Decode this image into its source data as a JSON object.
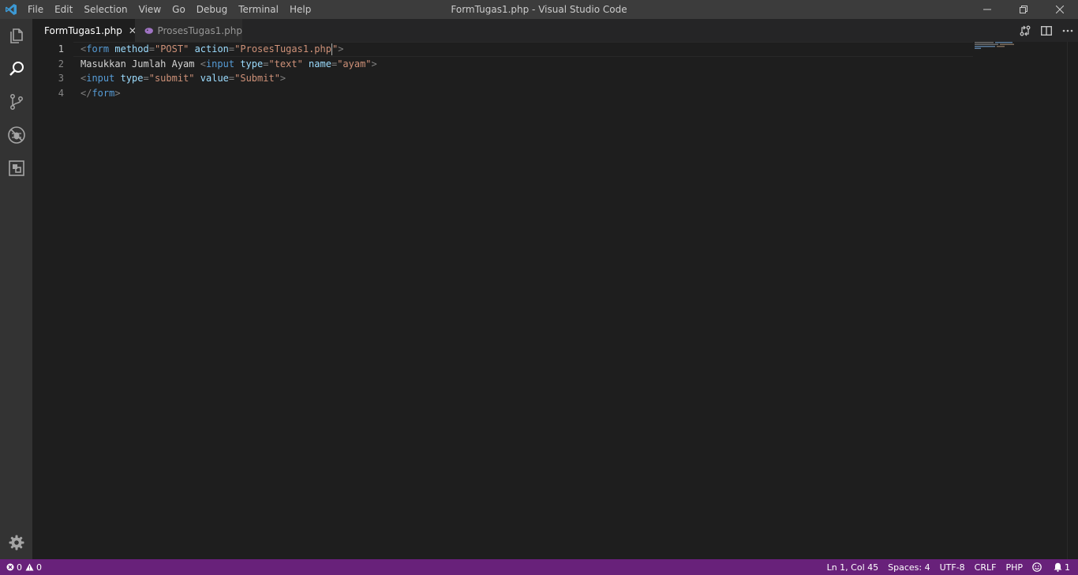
{
  "window": {
    "title": "FormTugas1.php - Visual Studio Code",
    "menu": [
      "File",
      "Edit",
      "Selection",
      "View",
      "Go",
      "Debug",
      "Terminal",
      "Help"
    ]
  },
  "activity_bar": {
    "items": [
      "files-icon",
      "search-icon",
      "source-control-icon",
      "debug-icon",
      "extensions-icon"
    ],
    "bottom": "gear-icon"
  },
  "tabs": [
    {
      "label": "FormTugas1.php",
      "active": true
    },
    {
      "label": "ProsesTugas1.php",
      "active": false
    }
  ],
  "editor": {
    "line_numbers": [
      "1",
      "2",
      "3",
      "4"
    ],
    "lines": [
      [
        [
          "p",
          "<"
        ],
        [
          "t",
          "form"
        ],
        [
          "x",
          " "
        ],
        [
          "a",
          "method"
        ],
        [
          "p",
          "="
        ],
        [
          "s",
          "\"POST\""
        ],
        [
          "x",
          " "
        ],
        [
          "a",
          "action"
        ],
        [
          "p",
          "="
        ],
        [
          "s",
          "\"ProsesTugas1.php"
        ],
        [
          "c",
          ""
        ],
        [
          "s",
          "\""
        ],
        [
          "p",
          ">"
        ]
      ],
      [
        [
          "x",
          "Masukkan Jumlah Ayam "
        ],
        [
          "p",
          "<"
        ],
        [
          "t",
          "input"
        ],
        [
          "x",
          " "
        ],
        [
          "a",
          "type"
        ],
        [
          "p",
          "="
        ],
        [
          "s",
          "\"text\""
        ],
        [
          "x",
          " "
        ],
        [
          "a",
          "name"
        ],
        [
          "p",
          "="
        ],
        [
          "s",
          "\"ayam\""
        ],
        [
          "p",
          ">"
        ]
      ],
      [
        [
          "p",
          "<"
        ],
        [
          "t",
          "input"
        ],
        [
          "x",
          " "
        ],
        [
          "a",
          "type"
        ],
        [
          "p",
          "="
        ],
        [
          "s",
          "\"submit\""
        ],
        [
          "x",
          " "
        ],
        [
          "a",
          "value"
        ],
        [
          "p",
          "="
        ],
        [
          "s",
          "\"Submit\""
        ],
        [
          "p",
          ">"
        ]
      ],
      [
        [
          "p",
          "</"
        ],
        [
          "t",
          "form"
        ],
        [
          "p",
          ">"
        ]
      ]
    ]
  },
  "status": {
    "errors": "0",
    "warnings": "0",
    "position": "Ln 1, Col 45",
    "spaces": "Spaces: 4",
    "encoding": "UTF-8",
    "eol": "CRLF",
    "language": "PHP",
    "notifications": "1"
  },
  "colors": {
    "statusbar": "#68217a",
    "tag": "#569cd6",
    "attr": "#9cdcfe",
    "string": "#ce9178",
    "php_icon": "#a074c4"
  }
}
